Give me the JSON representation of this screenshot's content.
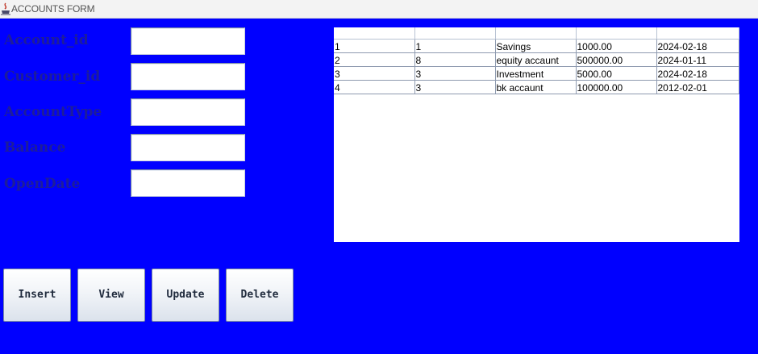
{
  "window": {
    "title": "ACCOUNTS FORM",
    "background": "#0000ff"
  },
  "form": {
    "fields": [
      {
        "label": "Account_id",
        "value": ""
      },
      {
        "label": "Customer_id",
        "value": ""
      },
      {
        "label": "AccountType",
        "value": ""
      },
      {
        "label": "Balance",
        "value": ""
      },
      {
        "label": "OpenDate",
        "value": ""
      }
    ]
  },
  "buttons": {
    "insert": "Insert",
    "view": "View",
    "update": "Update",
    "delete": "Delete"
  },
  "table": {
    "columns": [
      "",
      "",
      "",
      "",
      ""
    ],
    "rows": [
      [
        "1",
        "1",
        "Savings",
        "1000.00",
        "2024-02-18"
      ],
      [
        "2",
        "8",
        "equity accaunt",
        "500000.00",
        "2024-01-11"
      ],
      [
        "3",
        "3",
        "Investment",
        "5000.00",
        "2024-02-18"
      ],
      [
        "4",
        "3",
        "bk accaunt",
        "100000.00",
        "2012-02-01"
      ]
    ]
  }
}
